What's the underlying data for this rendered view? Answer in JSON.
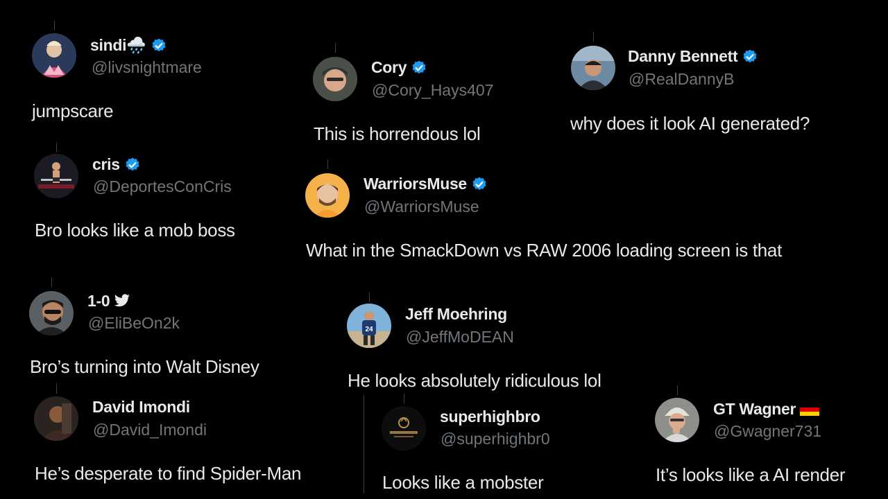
{
  "colors": {
    "background": "#000000",
    "text_primary": "#e7e9ea",
    "text_secondary": "#71767b",
    "verified_blue": "#1d9bf0"
  },
  "tweets": [
    {
      "display_name": "sindi🌧️",
      "handle": "@livsnightmare",
      "text": "jumpscare",
      "verified": true
    },
    {
      "display_name": "Cory",
      "handle": "@Cory_Hays407",
      "text": "This is horrendous lol",
      "verified": true
    },
    {
      "display_name": "Danny Bennett",
      "handle": "@RealDannyB",
      "text": "why does it look AI generated?",
      "verified": true
    },
    {
      "display_name": "cris",
      "handle": "@DeportesConCris",
      "text": "Bro looks like a mob boss",
      "verified": true
    },
    {
      "display_name": "WarriorsMuse",
      "handle": "@WarriorsMuse",
      "text": "What in the SmackDown vs RAW 2006 loading screen is that",
      "verified": true
    },
    {
      "display_name": "1-0",
      "handle": "@EliBeOn2k",
      "text": "Bro’s turning into Walt Disney",
      "verified": false,
      "name_icon": "twitter-bird-icon"
    },
    {
      "display_name": "Jeff Moehring",
      "handle": "@JeffMoDEAN",
      "text": "He looks absolutely ridiculous lol",
      "verified": false
    },
    {
      "display_name": "David Imondi",
      "handle": "@David_Imondi",
      "text": "He’s desperate to find Spider-Man",
      "verified": false
    },
    {
      "display_name": "superhighbro",
      "handle": "@superhighbr0",
      "text": "Looks like a mobster",
      "verified": false
    },
    {
      "display_name": "GT Wagner",
      "handle": "@Gwagner731",
      "text": "It’s looks like a AI render",
      "verified": false,
      "name_icon": "germany-flag-icon"
    }
  ]
}
